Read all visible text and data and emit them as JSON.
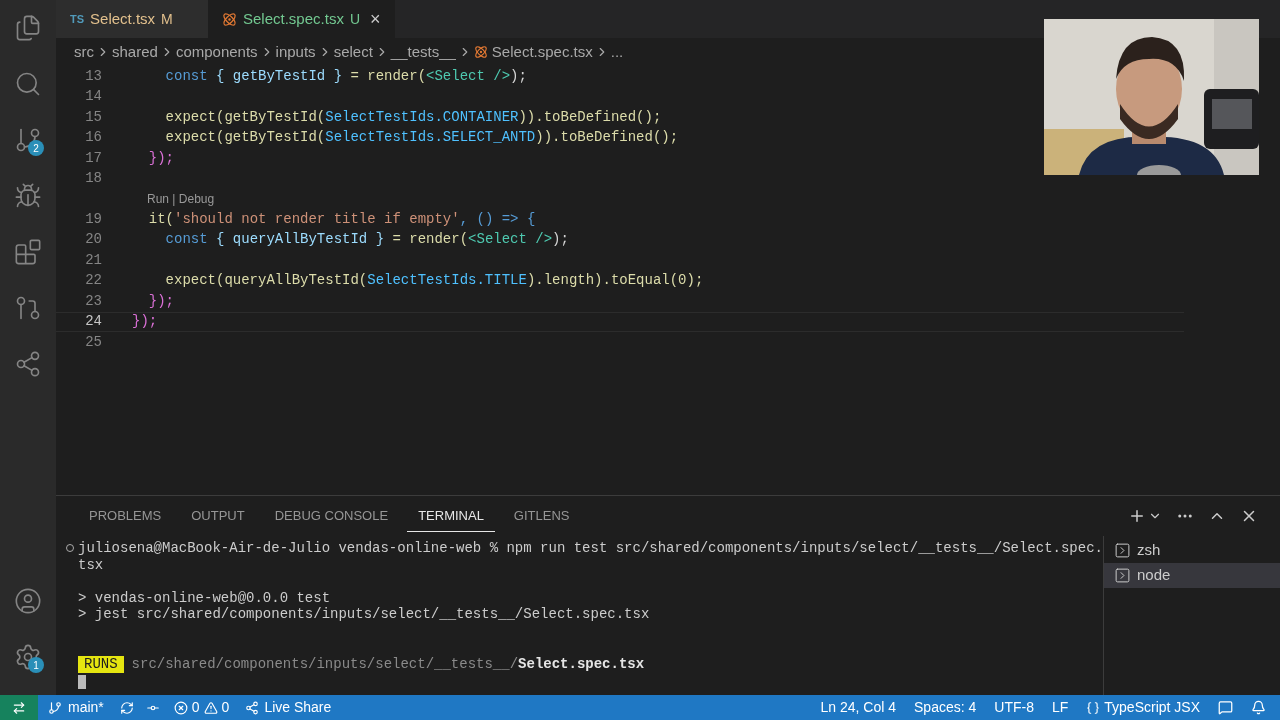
{
  "activity_bar": {
    "items": [
      {
        "kind": "files"
      },
      {
        "kind": "search"
      },
      {
        "kind": "source-control",
        "badge": "2"
      },
      {
        "kind": "run"
      },
      {
        "kind": "extensions"
      },
      {
        "kind": "git-graph"
      },
      {
        "kind": "live-share"
      }
    ],
    "bottom": [
      {
        "kind": "account"
      },
      {
        "kind": "settings",
        "badge": "1"
      }
    ]
  },
  "tabs": [
    {
      "type_label": "TS",
      "label": "Select.tsx",
      "status": "M",
      "selected": false
    },
    {
      "label": "Select.spec.tsx",
      "status": "U",
      "selected": true,
      "close": "×"
    }
  ],
  "breadcrumb": [
    "src",
    "shared",
    "components",
    "inputs",
    "select",
    "__tests__",
    "Select.spec.tsx",
    "..."
  ],
  "editor": {
    "lines": [
      {
        "number": "13",
        "current": false,
        "tokens": [
          {
            "kind": "keyword",
            "text": "    const"
          },
          {
            "kind": "variable",
            "text": " { getByTestId }"
          },
          {
            "kind": "function",
            "text": " = render("
          },
          {
            "kind": "component",
            "text": "<Select />"
          },
          {
            "kind": "plain",
            "text": ");"
          }
        ]
      },
      {
        "number": "14",
        "current": false
      },
      {
        "number": "15",
        "current": false,
        "tokens": [
          {
            "kind": "function",
            "text": "    expect(getByTestId("
          },
          {
            "kind": "constant",
            "text": "SelectTestIds.CONTAINER"
          },
          {
            "kind": "function",
            "text": ")).toBeDefined();"
          }
        ]
      },
      {
        "number": "16",
        "current": false,
        "tokens": [
          {
            "kind": "function",
            "text": "    expect(getByTestId("
          },
          {
            "kind": "constant",
            "text": "SelectTestIds.SELECT_ANTD"
          },
          {
            "kind": "function",
            "text": ")).toBeDefined();"
          }
        ]
      },
      {
        "number": "17",
        "current": false,
        "tokens": [
          {
            "kind": "brace",
            "text": "  });"
          }
        ]
      },
      {
        "number": "18",
        "current": false
      },
      {
        "number": "19",
        "current": false,
        "codelens": "Run | Debug",
        "tokens": [
          {
            "kind": "function",
            "text": "  it("
          },
          {
            "kind": "string",
            "text": "'should not render title if empty'"
          },
          {
            "kind": "keyword",
            "text": ", () => {"
          }
        ]
      },
      {
        "number": "20",
        "current": false,
        "tokens": [
          {
            "kind": "keyword",
            "text": "    const"
          },
          {
            "kind": "variable",
            "text": " { queryAllByTestId }"
          },
          {
            "kind": "function",
            "text": " = render("
          },
          {
            "kind": "component",
            "text": "<Select />"
          },
          {
            "kind": "plain",
            "text": ");"
          }
        ]
      },
      {
        "number": "21",
        "current": false
      },
      {
        "number": "22",
        "current": false,
        "tokens": [
          {
            "kind": "function",
            "text": "    expect(queryAllByTestId("
          },
          {
            "kind": "constant",
            "text": "SelectTestIds.TITLE"
          },
          {
            "kind": "function",
            "text": ").length).toEqual(0);"
          }
        ]
      },
      {
        "number": "23",
        "current": false,
        "tokens": [
          {
            "kind": "brace",
            "text": "  });"
          }
        ]
      },
      {
        "number": "24",
        "current": true,
        "tokens": [
          {
            "kind": "outer",
            "text": "});"
          }
        ]
      },
      {
        "number": "25",
        "current": false
      }
    ]
  },
  "panel": {
    "tabs": [
      {
        "label": "PROBLEMS",
        "selected": false
      },
      {
        "label": "OUTPUT",
        "selected": false
      },
      {
        "label": "DEBUG CONSOLE",
        "selected": false
      },
      {
        "label": "TERMINAL",
        "selected": true
      },
      {
        "label": "GITLENS",
        "selected": false
      }
    ],
    "terminal": [
      {
        "kind": "command",
        "text": "juliosena@MacBook-Air-de-Julio vendas-online-web % npm run test src/shared/components/inputs/select/__tests__/Select.spec."
      },
      {
        "kind": "output",
        "text": "tsx"
      },
      {
        "kind": "blank"
      },
      {
        "kind": "output",
        "text": "> vendas-online-web@0.0.0 test"
      },
      {
        "kind": "output",
        "text": "> jest src/shared/components/inputs/select/__tests__/Select.spec.tsx"
      },
      {
        "kind": "blank"
      },
      {
        "kind": "blank"
      },
      {
        "kind": "runs",
        "badge": "RUNS",
        "path": "src/shared/components/inputs/select/__tests__/",
        "file": "Select.spec.tsx"
      },
      {
        "kind": "cursor"
      }
    ],
    "sessions": [
      {
        "label": "zsh",
        "selected": false
      },
      {
        "label": "node",
        "selected": true
      }
    ]
  },
  "status_bar": {
    "branch": "main*",
    "errors": "0",
    "warnings": "0",
    "live_share": "Live Share",
    "position": "Ln 24, Col 4",
    "spaces": "Spaces: 4",
    "encoding": "UTF-8",
    "eol": "LF",
    "language": "TypeScript JSX"
  },
  "webcam": {
    "kind": "picture"
  }
}
